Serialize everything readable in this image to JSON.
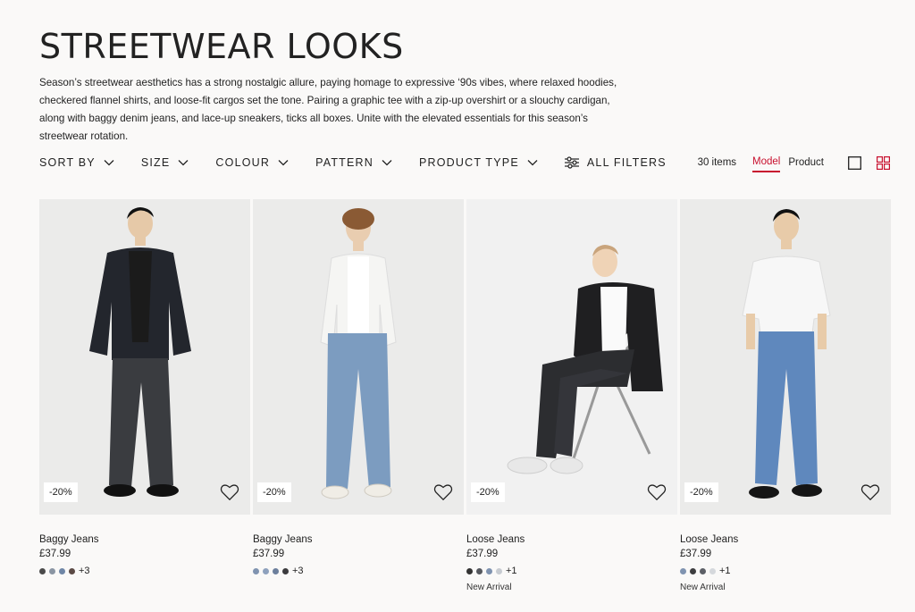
{
  "page": {
    "title": "STREETWEAR LOOKS",
    "intro": "Season’s streetwear aesthetics has a strong nostalgic allure, paying homage to expressive ‘90s vibes, where relaxed hoodies, checkered flannel shirts, and loose-fit cargos set the tone. Pairing a graphic tee with a zip-up overshirt or a slouchy cardigan, along with baggy denim jeans, and lace-up sneakers, ticks all boxes. Unite with the elevated essentials for this season’s streetwear rotation."
  },
  "filters": [
    {
      "label": "SORT BY"
    },
    {
      "label": "SIZE"
    },
    {
      "label": "COLOUR"
    },
    {
      "label": "PATTERN"
    },
    {
      "label": "PRODUCT TYPE"
    }
  ],
  "all_filters_label": "ALL FILTERS",
  "toolbar": {
    "items_count": "30 items",
    "view_model": "Model",
    "view_product": "Product"
  },
  "colors": {
    "accent": "#c8102e"
  },
  "products": [
    {
      "name": "Baggy Jeans",
      "price": "£37.99",
      "badge": "-20%",
      "swatches": [
        "#4a4a4a",
        "#8a95a3",
        "#6f86a6",
        "#5b4a45"
      ],
      "more": "+3",
      "tag": "",
      "outfit": {
        "jacket": "#23262d",
        "top": "#1b1b1b",
        "jeans": "#3a3c40",
        "shoes": "#111111"
      }
    },
    {
      "name": "Baggy Jeans",
      "price": "£37.99",
      "badge": "-20%",
      "swatches": [
        "#7f93b0",
        "#8ea1bd",
        "#6c7f9c",
        "#3b3b3d"
      ],
      "more": "+3",
      "tag": "",
      "outfit": {
        "jacket": "#f5f5f3",
        "top": "#ffffff",
        "jeans": "#7c9cc0",
        "shoes": "#f0ede6"
      }
    },
    {
      "name": "Loose Jeans",
      "price": "£37.99",
      "badge": "-20%",
      "swatches": [
        "#333333",
        "#55585e",
        "#7f93b0",
        "#c7cbd1"
      ],
      "more": "+1",
      "tag": "New Arrival",
      "outfit": {
        "jacket": "#1f1f21",
        "top": "#fafafa",
        "jeans": "#2c2d30",
        "shoes": "#e8e8e8"
      }
    },
    {
      "name": "Loose Jeans",
      "price": "£37.99",
      "badge": "-20%",
      "swatches": [
        "#7f93b0",
        "#3d3d3f",
        "#5c5f66",
        "#d5d8dc"
      ],
      "more": "+1",
      "tag": "New Arrival",
      "outfit": {
        "jacket": "#f7f7f7",
        "top": "#ffffff",
        "jeans": "#5f88bd",
        "shoes": "#151515"
      }
    }
  ]
}
